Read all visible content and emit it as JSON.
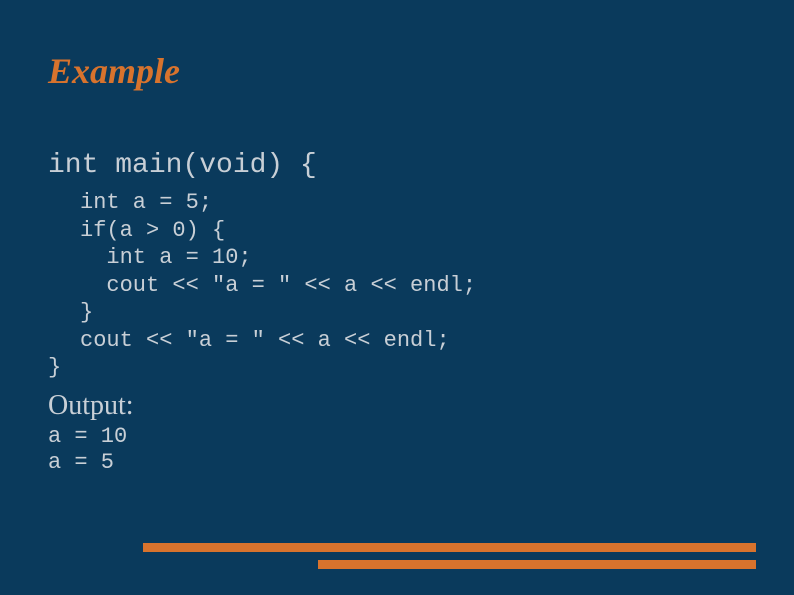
{
  "slide": {
    "title": "Example",
    "code_main": "int main(void) {",
    "code_body": "int a = 5;\nif(a > 0) {\n  int a = 10;\n  cout << \"a = \" << a << endl;\n}\ncout << \"a = \" << a << endl;",
    "code_close": "}",
    "output_label": "Output:",
    "output_body": "a = 10\na = 5"
  }
}
